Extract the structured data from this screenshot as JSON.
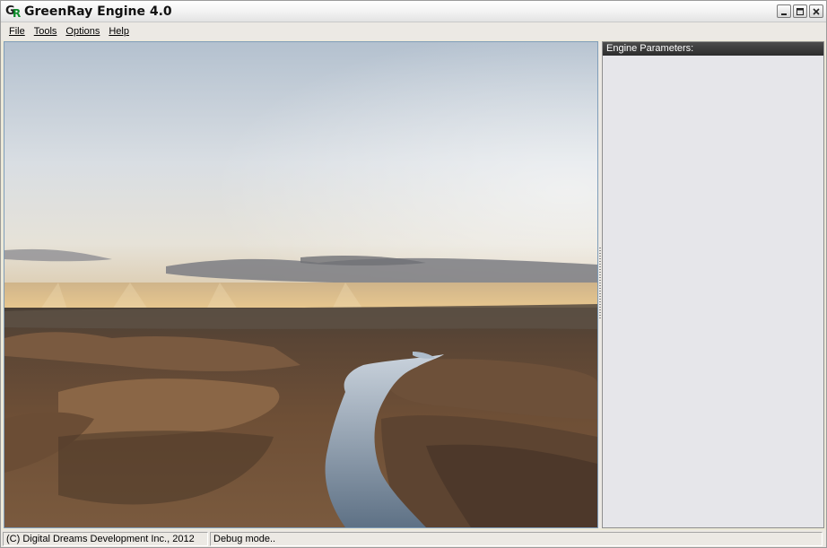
{
  "window": {
    "title": "GreenRay Engine 4.0",
    "icon": "greenray-logo-icon",
    "controls": [
      "minimize-icon",
      "maximize-icon",
      "close-icon"
    ]
  },
  "menu": {
    "file": "File",
    "tools": "Tools",
    "options": "Options",
    "help": "Help"
  },
  "viewport": {
    "content": "rendered terrain scene"
  },
  "panel": {
    "header": "Engine Parameters:"
  },
  "status": {
    "copyright": "(C) Digital Dreams Development Inc., 2012",
    "mode": "Debug mode.."
  },
  "colors": {
    "panel_header_bg": "#3a3a3a",
    "panel_bg": "#e6e6ea",
    "chrome_bg": "#ece9e4",
    "water": "#7f93a8",
    "terrain": "#6b4c33"
  }
}
